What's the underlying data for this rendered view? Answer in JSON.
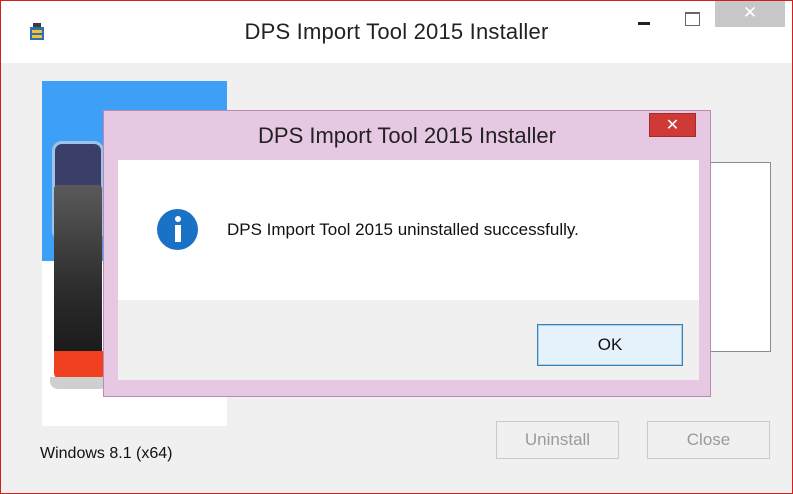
{
  "main_window": {
    "title": "DPS Import Tool 2015 Installer",
    "os_label": "Windows 8.1 (x64)",
    "uninstall_label": "Uninstall",
    "close_label": "Close",
    "minimize_icon": "minimize-icon",
    "maximize_icon": "maximize-icon",
    "close_icon": "close-icon",
    "close_glyph": "✕"
  },
  "message_box": {
    "title": "DPS Import Tool 2015 Installer",
    "message": "DPS Import Tool 2015 uninstalled successfully.",
    "ok_label": "OK",
    "icon": "info-icon",
    "close_glyph": "✕"
  },
  "colors": {
    "info_blue": "#1a72c6",
    "close_red": "#cf3a36",
    "dialog_frame": "#e6c8e2",
    "banner_blue": "#3d9ff5"
  }
}
